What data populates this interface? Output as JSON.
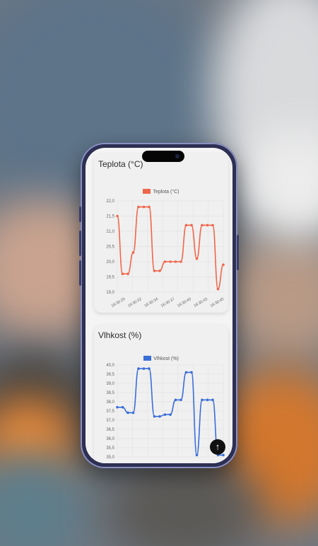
{
  "charts": {
    "temperature": {
      "title": "Teplota (°C)",
      "legend": "Teplota (°C)",
      "color": "#f0664a",
      "chart_data": {
        "type": "line",
        "y_ticks": [
          "22,0",
          "21,5",
          "21,0",
          "20,5",
          "20,0",
          "19,5",
          "19,0"
        ],
        "ylim": [
          19.0,
          22.0
        ],
        "x_tick_labels": [
          "18:30:29",
          "18:30:32",
          "18:30:34",
          "18:30:37",
          "18:30:40",
          "18:30:43",
          "18:30:45"
        ],
        "values": [
          21.5,
          19.6,
          19.6,
          20.3,
          21.8,
          21.8,
          21.8,
          19.7,
          19.7,
          20.0,
          20.0,
          20.0,
          20.0,
          21.2,
          21.2,
          20.1,
          21.2,
          21.2,
          21.2,
          19.1,
          19.9
        ],
        "grid": true,
        "legend_position": "top"
      }
    },
    "humidity": {
      "title": "Vlhkost (%)",
      "legend": "Vlhkost (%)",
      "color": "#3a6ed8",
      "chart_data": {
        "type": "line",
        "y_ticks": [
          "40,0",
          "39,5",
          "39,0",
          "38,5",
          "38,0",
          "37,5",
          "37,0",
          "36,5",
          "36,0",
          "35,5",
          "35,0"
        ],
        "ylim": [
          35.0,
          40.0
        ],
        "values": [
          37.7,
          37.7,
          37.4,
          37.4,
          39.8,
          39.8,
          39.8,
          37.2,
          37.2,
          37.3,
          37.3,
          38.1,
          38.1,
          39.6,
          39.6,
          35.1,
          38.1,
          38.1,
          38.1,
          35.1,
          35.1
        ],
        "grid": true,
        "legend_position": "top"
      }
    }
  },
  "fab": {
    "icon": "arrow-up-icon",
    "glyph": "↑"
  }
}
